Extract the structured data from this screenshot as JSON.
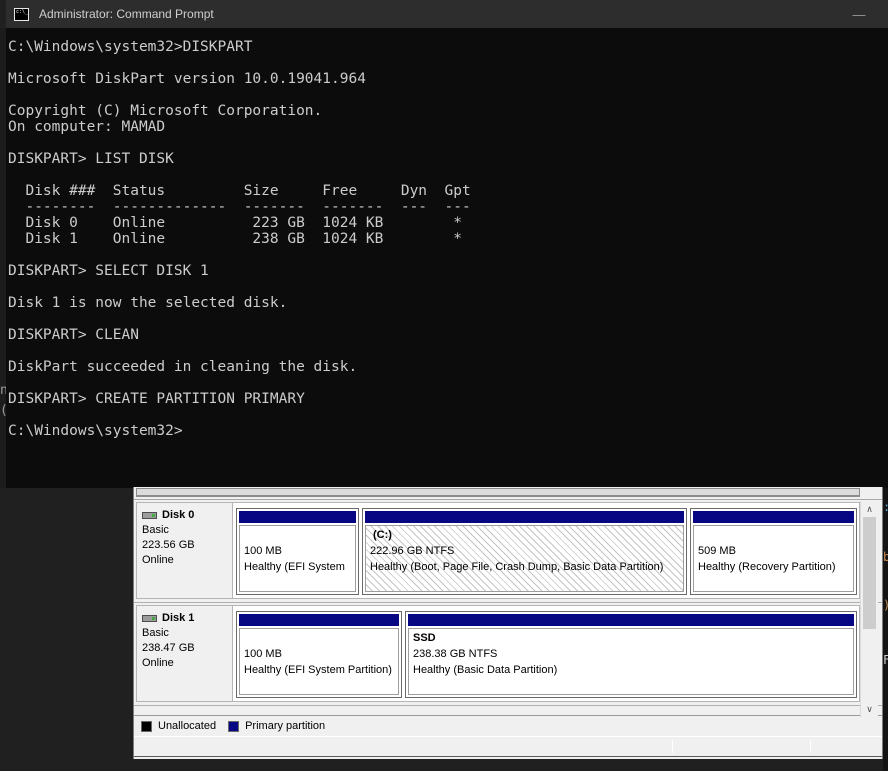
{
  "cmd": {
    "window_title": "Administrator: Command Prompt",
    "minimize_glyph": "—",
    "icon_text": "c:\\_",
    "terminal_text": "C:\\Windows\\system32>DISKPART\n\nMicrosoft DiskPart version 10.0.19041.964\n\nCopyright (C) Microsoft Corporation.\nOn computer: MAMAD\n\nDISKPART> LIST DISK\n\n  Disk ###  Status         Size     Free     Dyn  Gpt\n  --------  -------------  -------  -------  ---  ---\n  Disk 0    Online          223 GB  1024 KB        *\n  Disk 1    Online          238 GB  1024 KB        *\n\nDISKPART> SELECT DISK 1\n\nDisk 1 is now the selected disk.\n\nDISKPART> CLEAN\n\nDiskPart succeeded in cleaning the disk.\n\nDISKPART> CREATE PARTITION PRIMARY\n\nC:\\Windows\\system32>"
  },
  "disk_management": {
    "disks": [
      {
        "name": "Disk 0",
        "type": "Basic",
        "size": "223.56 GB",
        "status": "Online",
        "partitions": [
          {
            "title": "",
            "size_line": "100 MB",
            "health_line": "Healthy (EFI System"
          },
          {
            "title": "(C:)",
            "size_line": "222.96 GB NTFS",
            "health_line": "Healthy (Boot, Page File, Crash Dump, Basic Data Partition)"
          },
          {
            "title": "",
            "size_line": "509 MB",
            "health_line": "Healthy (Recovery Partition)"
          }
        ]
      },
      {
        "name": "Disk 1",
        "type": "Basic",
        "size": "238.47 GB",
        "status": "Online",
        "partitions": [
          {
            "title": "",
            "size_line": "100 MB",
            "health_line": "Healthy (EFI System Partition)"
          },
          {
            "title": "SSD",
            "size_line": "238.38 GB NTFS",
            "health_line": "Healthy (Basic Data Partition)"
          }
        ]
      }
    ],
    "legend": {
      "unallocated_label": "Unallocated",
      "primary_label": "Primary partition"
    },
    "scrollbar": {
      "up_glyph": "∧",
      "down_glyph": "∨"
    }
  },
  "edge_fragments": {
    "left": [
      "n",
      "("
    ],
    "right": [
      ":",
      "b",
      ")",
      "F"
    ]
  },
  "colors": {
    "titlebar_bg": "#2d2d2d",
    "terminal_bg": "#0c0c0c",
    "primary_partition": "#070784",
    "unallocated": "#000000",
    "fragment_orange": "#c58a52",
    "fragment_blue": "#4f9fd0",
    "fragment_gray": "#cccccc"
  }
}
